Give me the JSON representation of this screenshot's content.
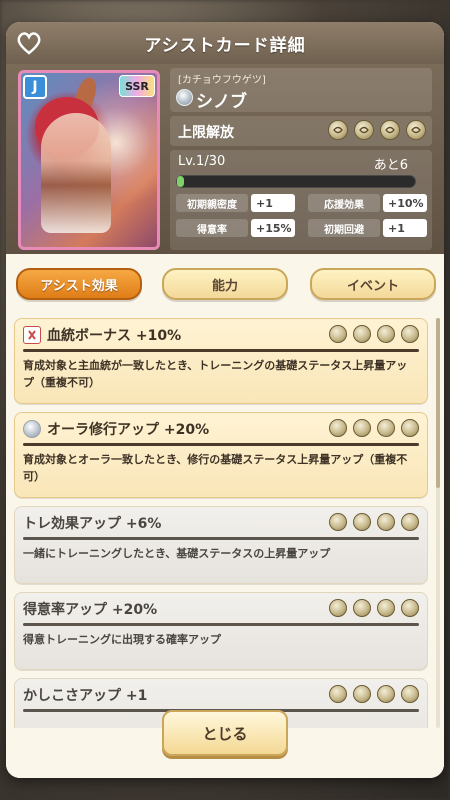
{
  "header": {
    "title": "アシストカード詳細"
  },
  "card": {
    "type_badge": "J",
    "rarity": "SSR",
    "epithet": "[カチョウフウゲツ]",
    "name": "シノブ"
  },
  "limit_break": {
    "label": "上限解放",
    "coins": 4
  },
  "level": {
    "text": "Lv.1/30",
    "remaining": "あと6",
    "progress": 0.03
  },
  "stats": [
    {
      "label": "初期親密度",
      "value": "+1"
    },
    {
      "label": "応援効果",
      "value": "+10%"
    },
    {
      "label": "得意率",
      "value": "+15%"
    },
    {
      "label": "初期回避",
      "value": "+1"
    }
  ],
  "tabs": [
    {
      "label": "アシスト効果",
      "active": true
    },
    {
      "label": "能力",
      "active": false
    },
    {
      "label": "イベント",
      "active": false
    }
  ],
  "effects": [
    {
      "title": "血統ボーナス +10%",
      "desc": "育成対象と主血統が一致したとき、トレーニングの基礎ステータス上昇量アップ（重複不可）",
      "icon": "blood-icon",
      "active": true
    },
    {
      "title": "オーラ修行アップ +20%",
      "desc": "育成対象とオーラ一致したとき、修行の基礎ステータス上昇量アップ（重複不可）",
      "icon": "aura-icon",
      "active": true
    },
    {
      "title": "トレ効果アップ +6%",
      "desc": "一緒にトレーニングしたとき、基礎ステータスの上昇量アップ",
      "icon": "",
      "active": false
    },
    {
      "title": "得意率アップ +20%",
      "desc": "得意トレーニングに出現する確率アップ",
      "icon": "",
      "active": false
    },
    {
      "title": "かしこさアップ +1",
      "desc": "",
      "icon": "",
      "active": false
    }
  ],
  "footer": {
    "close_label": "とじる"
  },
  "colors": {
    "accent": "#e07d18",
    "header_bg": "#7a6b59",
    "level_fill": "#7ed26a"
  }
}
